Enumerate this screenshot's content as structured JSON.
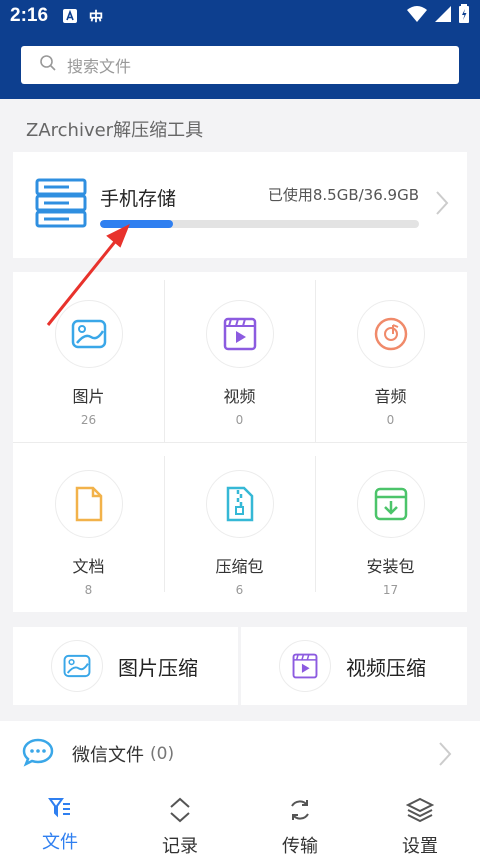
{
  "status_bar": {
    "time": "2:16"
  },
  "search": {
    "placeholder": "搜索文件"
  },
  "section_title": "ZArchiver解压缩工具",
  "storage": {
    "name": "手机存储",
    "used_text": "已使用8.5GB/36.9GB",
    "used_fraction": 0.23
  },
  "categories": [
    {
      "label": "图片",
      "count": "26",
      "icon": "image-icon",
      "color": "#3aa7e8"
    },
    {
      "label": "视频",
      "count": "0",
      "icon": "video-icon",
      "color": "#8c5be0"
    },
    {
      "label": "音频",
      "count": "0",
      "icon": "audio-icon",
      "color": "#f08a6a"
    },
    {
      "label": "文档",
      "count": "8",
      "icon": "document-icon",
      "color": "#f2b24a"
    },
    {
      "label": "压缩包",
      "count": "6",
      "icon": "archive-icon",
      "color": "#35b8d6"
    },
    {
      "label": "安装包",
      "count": "17",
      "icon": "install-icon",
      "color": "#4cc46a"
    }
  ],
  "compress": {
    "image_label": "图片压缩",
    "video_label": "视频压缩"
  },
  "wechat": {
    "label": "微信文件",
    "count": "(0)"
  },
  "tabs": [
    {
      "label": "文件",
      "active": true
    },
    {
      "label": "记录",
      "active": false
    },
    {
      "label": "传输",
      "active": false
    },
    {
      "label": "设置",
      "active": false
    }
  ],
  "colors": {
    "header": "#0d3f8f",
    "accent": "#2f7ff0",
    "annotation_arrow": "#e8322c"
  }
}
